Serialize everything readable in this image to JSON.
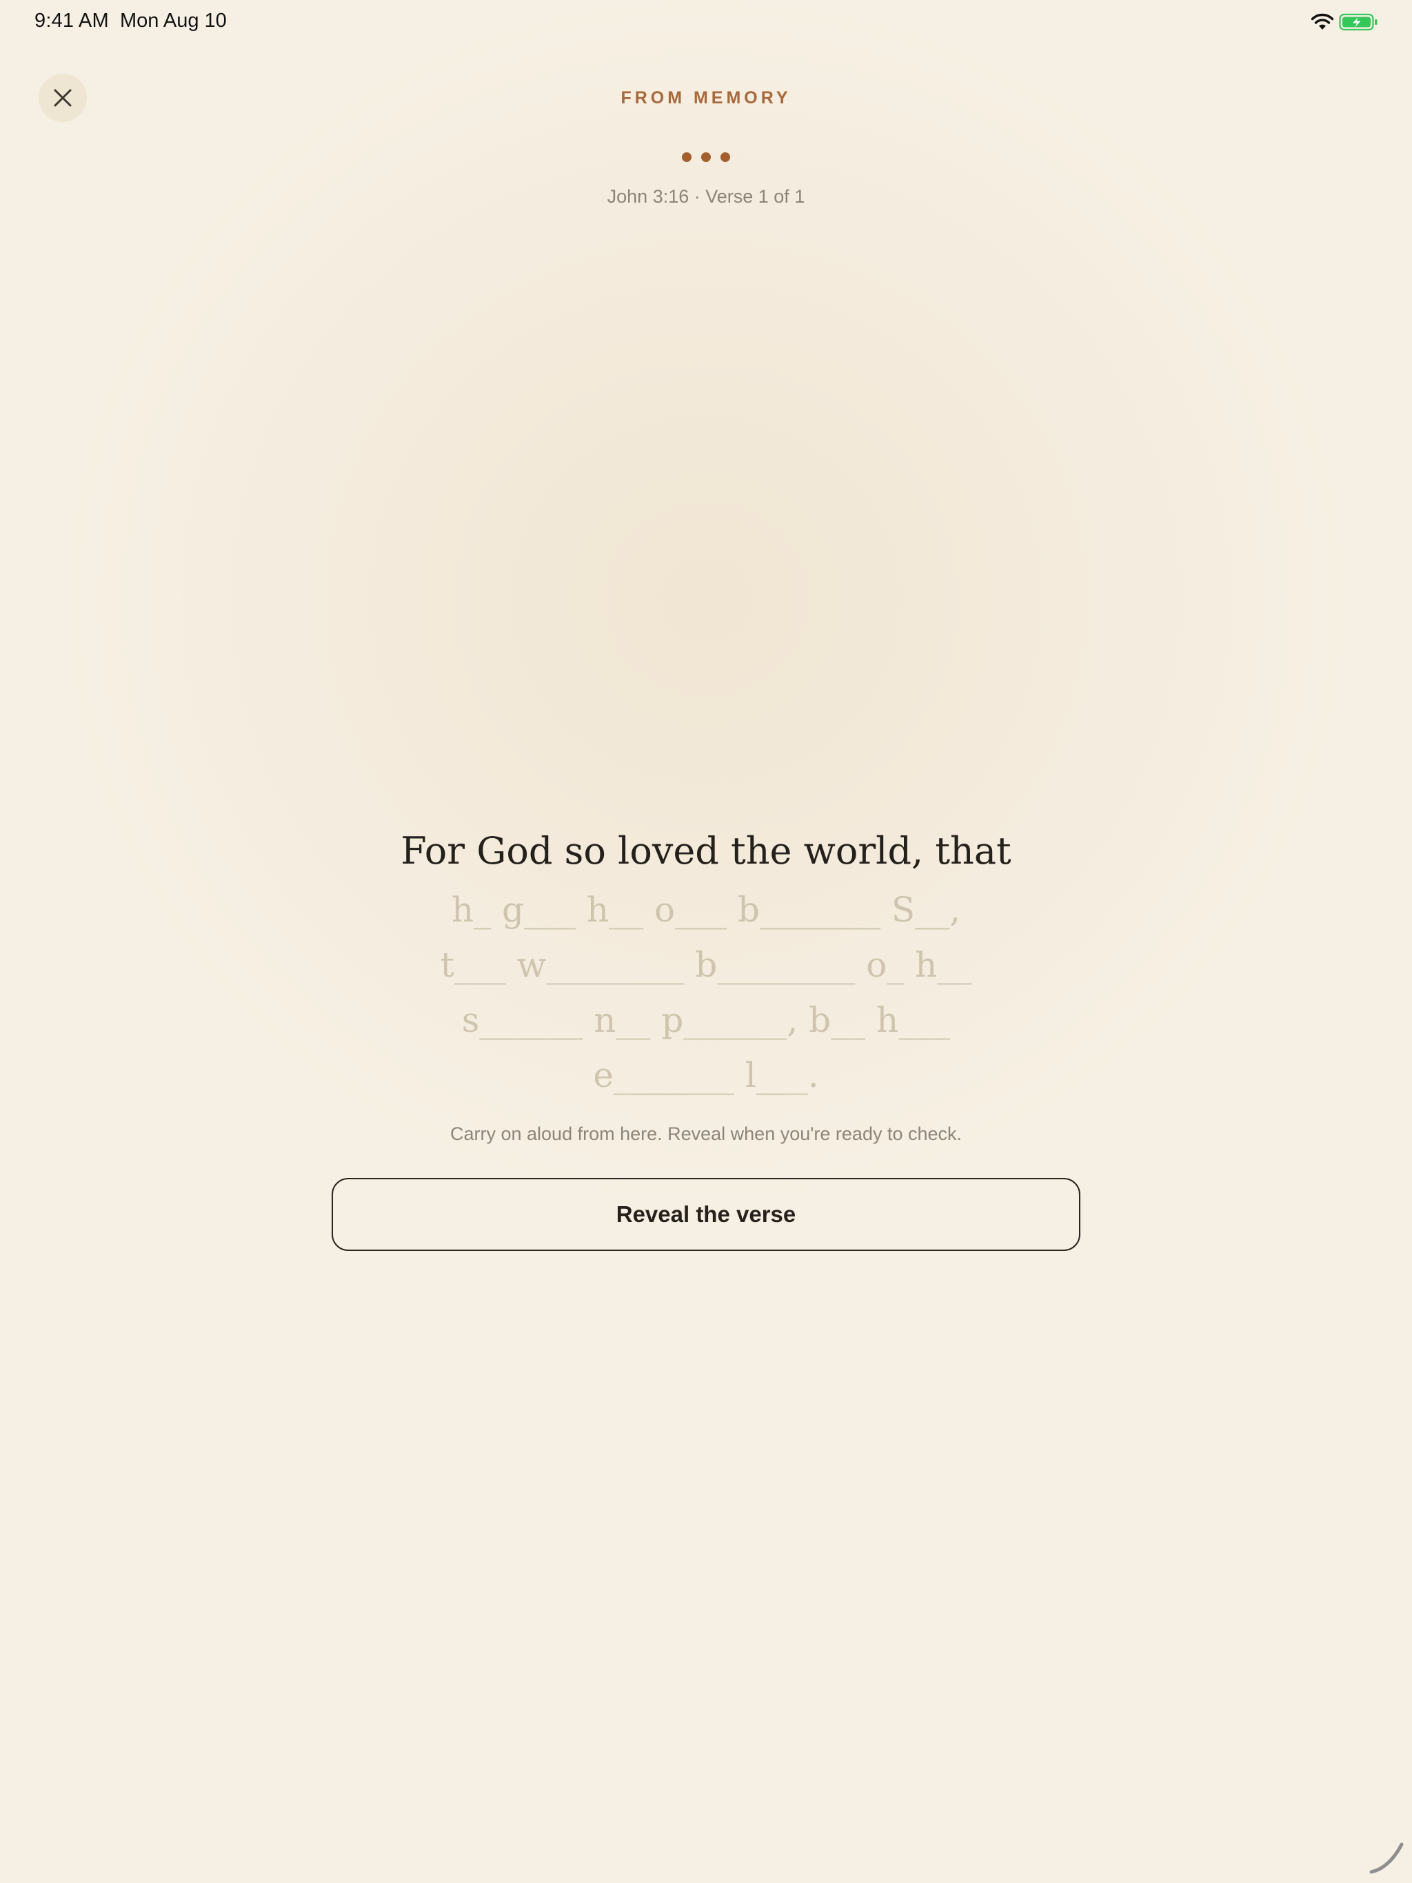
{
  "status_bar": {
    "time": "9:41 AM",
    "date": "Mon Aug 10",
    "wifi_icon": "wifi-icon",
    "battery_icon": "battery-charging-icon"
  },
  "header": {
    "close_icon": "close-icon",
    "mode_title": "FROM MEMORY",
    "progress_icon": "ellipsis-dots",
    "reference": "John 3:16 · Verse 1 of 1"
  },
  "verse": {
    "known_line": "For God so loved the world, that",
    "hint_lines": [
      "h_ g___ h__ o___ b_______ S__,",
      "t___ w________ b________ o_ h__",
      "s______ n__ p______, b__ h___",
      "e_______ l___."
    ]
  },
  "instruction": "Carry on aloud from here. Reveal when you're ready to check.",
  "actions": {
    "reveal_label": "Reveal the verse"
  },
  "colors": {
    "background": "#f6f0e4",
    "accent": "#a7683a",
    "text_primary": "#24201b",
    "text_hint": "#cfc4ae",
    "text_secondary": "#8c8478",
    "battery_green": "#34c759"
  }
}
